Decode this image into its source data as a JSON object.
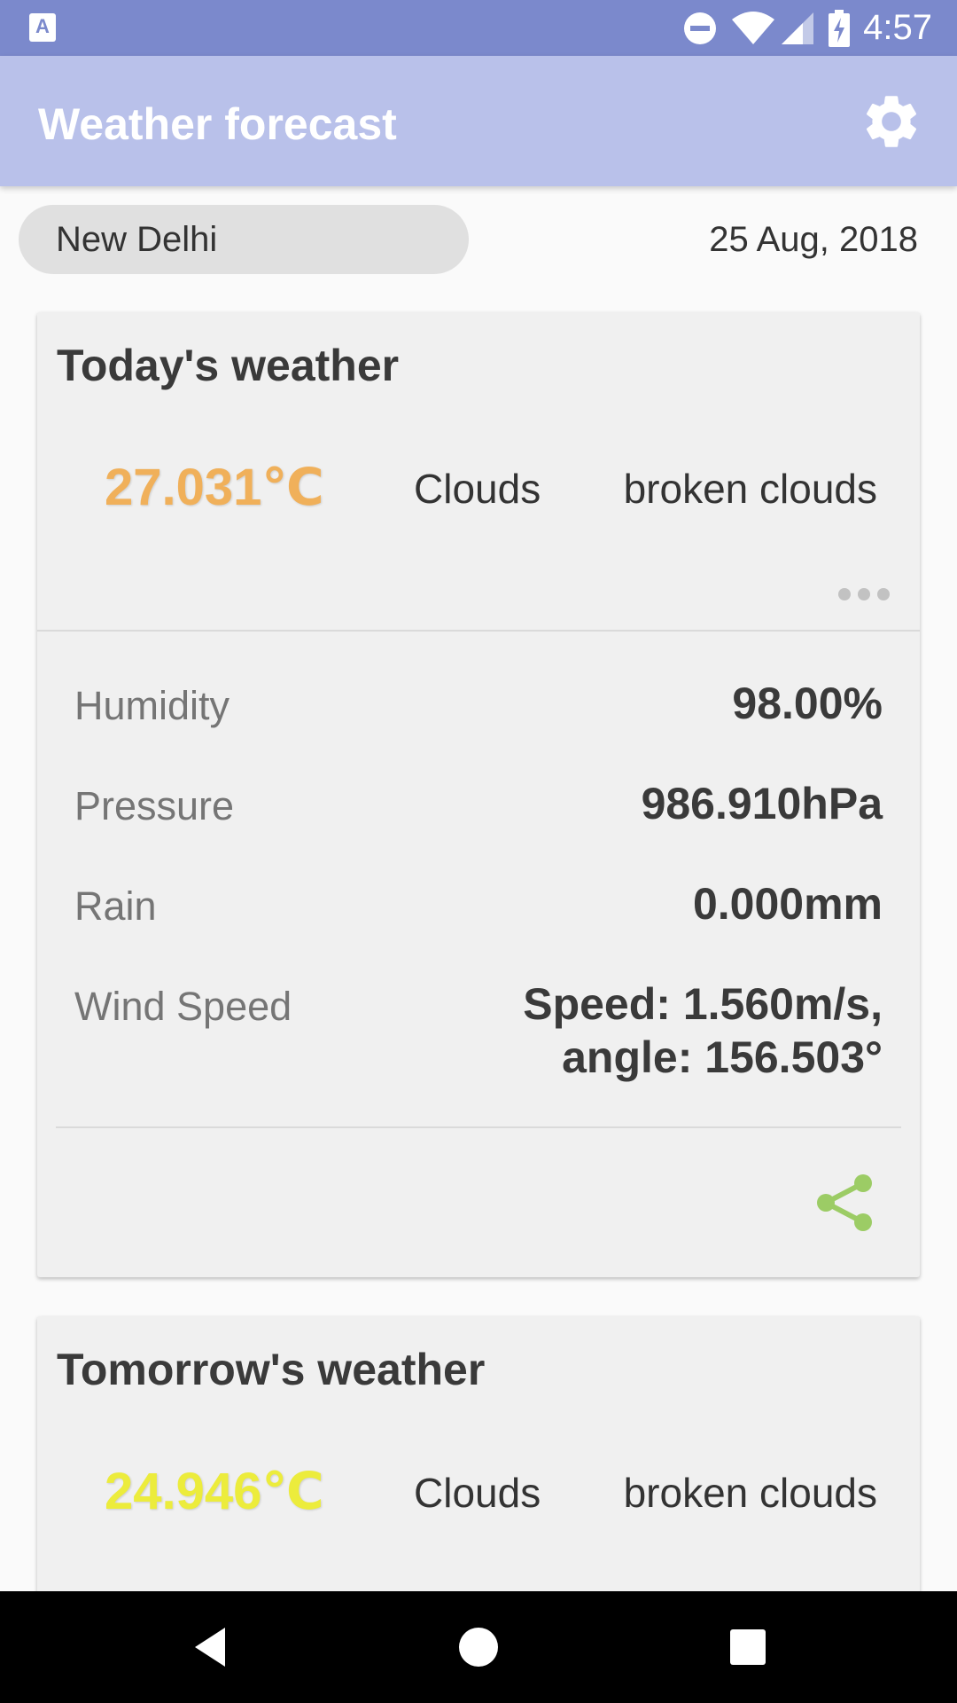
{
  "status_bar": {
    "time": "4:57",
    "icons": [
      "app-notification-icon",
      "do-not-disturb-icon",
      "wifi-icon",
      "cell-signal-icon",
      "battery-charging-icon"
    ],
    "color": "#7b89cc"
  },
  "app_bar": {
    "title": "Weather forecast",
    "settings_icon": "gear-icon",
    "color": "#b9c1ea"
  },
  "location": {
    "city": "New Delhi",
    "date": "25 Aug, 2018"
  },
  "today": {
    "title": "Today's weather",
    "temperature": "27.031℃",
    "temperature_color": "#f0b05a",
    "condition": "Clouds",
    "description": "broken clouds",
    "details": [
      {
        "label": "Humidity",
        "value": "98.00%"
      },
      {
        "label": "Pressure",
        "value": "986.910hPa"
      },
      {
        "label": "Rain",
        "value": "0.000mm"
      },
      {
        "label": "Wind Speed",
        "value_line1": "Speed: 1.560m/s,",
        "value_line2": "angle: 156.503°"
      }
    ],
    "share_icon": "share-icon",
    "share_color": "#9ccc65"
  },
  "tomorrow": {
    "title": "Tomorrow's weather",
    "temperature": "24.946℃",
    "temperature_color": "#ecec3c",
    "condition": "Clouds",
    "description": "broken clouds"
  },
  "nav_bar": {
    "buttons": [
      "back-icon",
      "home-icon",
      "recents-icon"
    ]
  }
}
